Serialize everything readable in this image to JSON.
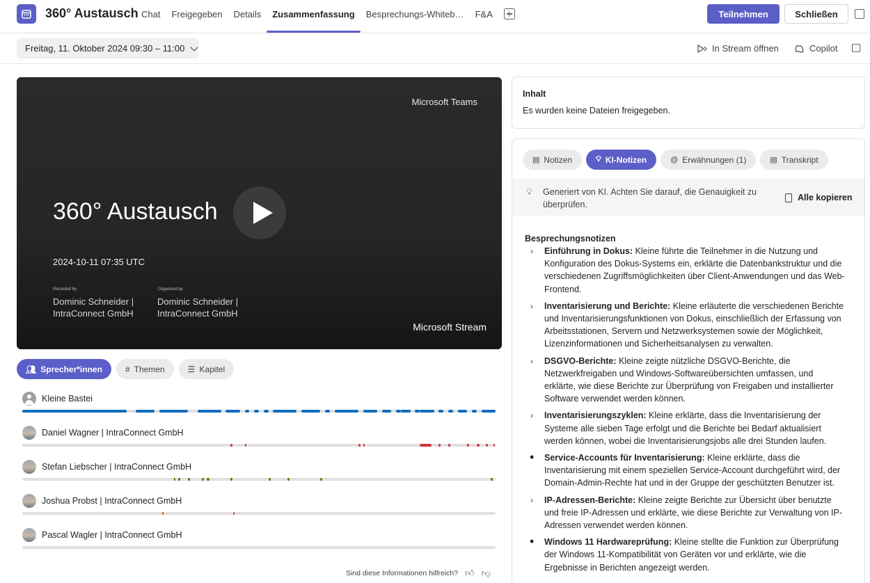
{
  "header": {
    "title": "360° Austausch",
    "tabs": [
      "Chat",
      "Freigegeben",
      "Details",
      "Zusammenfassung",
      "Besprechungs-Whiteb…",
      "F&A"
    ],
    "active_tab": "Zusammenfassung",
    "join_label": "Teilnehmen",
    "close_label": "Schließen",
    "accent": "#5b5fc7"
  },
  "subheader": {
    "date": "Freitag, 11. Oktober 2024 09:30 – 11:00",
    "stream_label": "In Stream öffnen",
    "copilot_label": "Copilot"
  },
  "video": {
    "brand_top": "Microsoft Teams",
    "title": "360° Austausch",
    "timestamp": "2024-10-11 07:35 UTC",
    "recorded_by_label": "Recorded by",
    "recorded_by": "Dominic Schneider | IntraConnect GmbH",
    "organized_by_label": "Organized by",
    "organized_by": "Dominic Schneider | IntraConnect GmbH",
    "brand_bottom": "Microsoft Stream"
  },
  "filters": {
    "speakers": "Sprecher*innen",
    "topics": "Themen",
    "chapters": "Kapitel"
  },
  "speakers": [
    {
      "name": "Kleine Bastei",
      "color": "#0f6cbd"
    },
    {
      "name": "Daniel Wagner | IntraConnect GmbH",
      "color": "#d13438"
    },
    {
      "name": "Stefan Liebscher | IntraConnect GmbH",
      "color": "#498205"
    },
    {
      "name": "Joshua Probst | IntraConnect GmbH",
      "color": "#e3561d"
    },
    {
      "name": "Pascal Wagler | IntraConnect GmbH",
      "color": "#0f6cbd"
    }
  ],
  "feedback": {
    "question": "Sind diese Informationen hilfreich?"
  },
  "content": {
    "heading": "Inhalt",
    "body": "Es wurden keine Dateien freigegeben."
  },
  "notes_tabs": [
    "Notizen",
    "KI-Notizen",
    "Erwähnungen (1)",
    "Transkript"
  ],
  "ai_banner": {
    "text": "Generiert von KI. Achten Sie darauf, die Genauigkeit zu überprüfen.",
    "copy_label": "Alle kopieren"
  },
  "notes": {
    "title": "Besprechungsnotizen",
    "items": [
      {
        "marker": "chevron",
        "title": "Einführung in Dokus:",
        "text": " Kleine führte die Teilnehmer in die Nutzung und Konfiguration des Dokus-Systems ein, erklärte die Datenbankstruktur und die verschiedenen Zugriffsmöglichkeiten über Client-Anwendungen und das Web-Frontend."
      },
      {
        "marker": "chevron",
        "title": "Inventarisierung und Berichte:",
        "text": " Kleine erläuterte die verschiedenen Berichte und Inventarisierungsfunktionen von Dokus, einschließlich der Erfassung von Arbeitsstationen, Servern und Netzwerksystemen sowie der Möglichkeit, Lizenzinformationen und Sicherheitsanalysen zu verwalten."
      },
      {
        "marker": "chevron",
        "title": "DSGVO-Berichte:",
        "text": " Kleine zeigte nützliche DSGVO-Berichte, die Netzwerkfreigaben und Windows-Softwareübersichten umfassen, und erklärte, wie diese Berichte zur Überprüfung von Freigaben und installierter Software verwendet werden können."
      },
      {
        "marker": "chevron",
        "title": "Inventarisierungszyklen:",
        "text": " Kleine erklärte, dass die Inventarisierung der Systeme alle sieben Tage erfolgt und die Berichte bei Bedarf aktualisiert werden können, wobei die Inventarisierungsjobs alle drei Stunden laufen."
      },
      {
        "marker": "dot",
        "title": "Service-Accounts für Inventarisierung:",
        "text": " Kleine erklärte, dass die Inventarisierung mit einem speziellen Service-Account durchgeführt wird, der Domain-Admin-Rechte hat und in der Gruppe der geschützten Benutzer ist."
      },
      {
        "marker": "chevron",
        "title": "IP-Adressen-Berichte:",
        "text": " Kleine zeigte Berichte zur Übersicht über benutzte und freie IP-Adressen und erklärte, wie diese Berichte zur Verwaltung von IP-Adressen verwendet werden können."
      },
      {
        "marker": "dot",
        "title": "Windows 11 Hardwareprüfung:",
        "text": " Kleine stellte die Funktion zur Überprüfung der Windows 11-Kompatibilität von Geräten vor und erklärte, wie die Ergebnisse in Berichten angezeigt werden."
      }
    ]
  }
}
